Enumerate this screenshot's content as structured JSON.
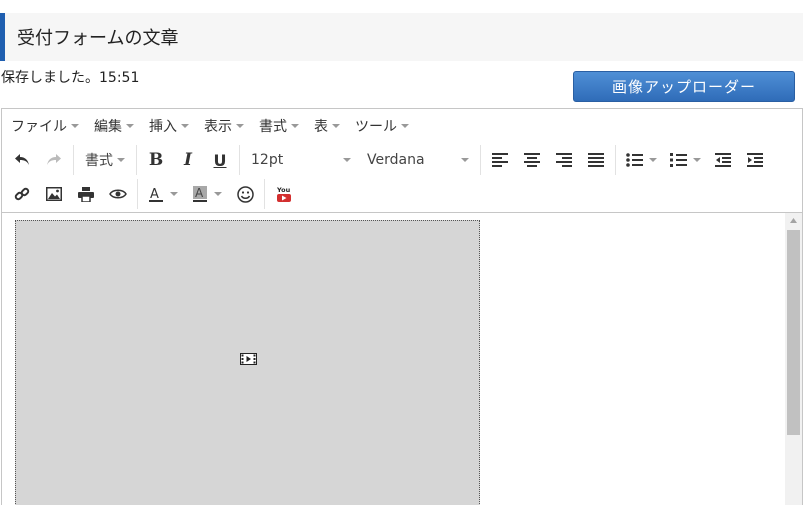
{
  "page": {
    "title": "受付フォームの文章",
    "save_status": "保存しました。15:51",
    "uploader_button": "画像アップローダー"
  },
  "editor": {
    "menu": [
      "ファイル",
      "編集",
      "挿入",
      "表示",
      "書式",
      "表",
      "ツール"
    ],
    "toolbar": {
      "format_label": "書式",
      "font_size": "12pt",
      "font_family": "Verdana",
      "youtube_icon_text": "You"
    }
  },
  "colors": {
    "accent": "#1f5fb0",
    "button": "#3a7bc8",
    "placeholder_bg": "#d6d6d6"
  }
}
